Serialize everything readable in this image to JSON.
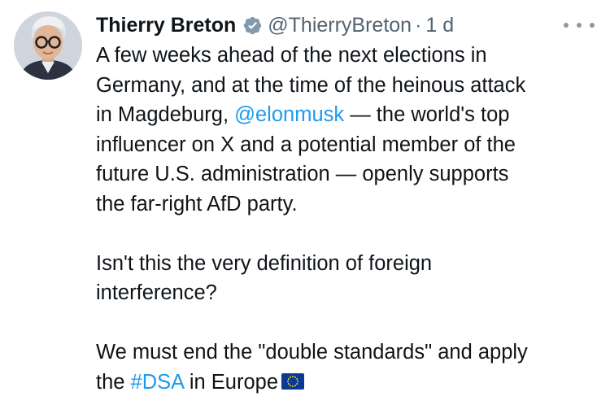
{
  "tweet": {
    "author": {
      "name": "Thierry Breton",
      "handle": "@ThierryBreton",
      "separator": "·",
      "time": "1 d",
      "verified_icon": "verified-badge-icon",
      "badge_color": "#829aab"
    },
    "more_icon": "more-horizontal-icon",
    "paragraphs": {
      "p1": {
        "line1": "A few weeks ahead of the next elections in",
        "line2": "Germany, and at the time of the heinous attack",
        "line3_pre": "in Magdeburg, ",
        "mention": "@elonmusk",
        "line3_post": " — the world's top",
        "line4": "influencer on X and a potential member of the",
        "line5": "future U.S. administration — openly supports",
        "line6": "the far-right AfD party."
      },
      "p2": {
        "line1": "Isn't this the very definition of foreign",
        "line2": "interference?"
      },
      "p3": {
        "line1": "We must end the \"double standards\" and apply",
        "line2_pre": "the ",
        "hashtag": "#DSA",
        "line2_post": " in Europe"
      }
    },
    "flag_icon": "eu-flag-icon",
    "colors": {
      "text": "#0f1419",
      "secondary": "#536471",
      "link": "#1d9bf0",
      "eu_blue": "#0b3a93",
      "eu_yellow": "#ffd617"
    }
  }
}
